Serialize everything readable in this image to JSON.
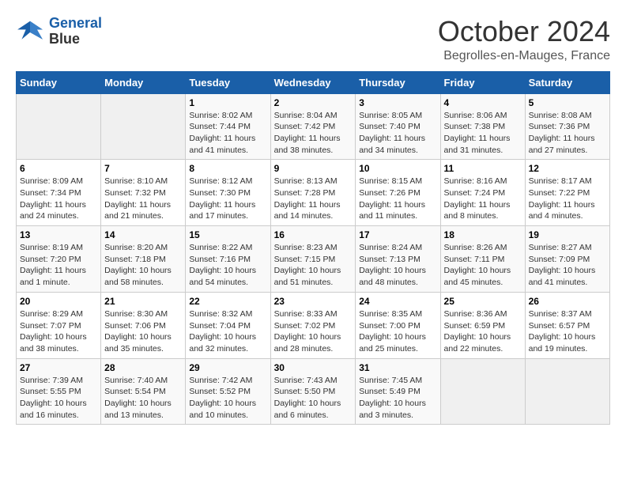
{
  "logo": {
    "line1": "General",
    "line2": "Blue"
  },
  "title": "October 2024",
  "location": "Begrolles-en-Mauges, France",
  "days_header": [
    "Sunday",
    "Monday",
    "Tuesday",
    "Wednesday",
    "Thursday",
    "Friday",
    "Saturday"
  ],
  "weeks": [
    [
      {
        "num": "",
        "info": ""
      },
      {
        "num": "",
        "info": ""
      },
      {
        "num": "1",
        "info": "Sunrise: 8:02 AM\nSunset: 7:44 PM\nDaylight: 11 hours and 41 minutes."
      },
      {
        "num": "2",
        "info": "Sunrise: 8:04 AM\nSunset: 7:42 PM\nDaylight: 11 hours and 38 minutes."
      },
      {
        "num": "3",
        "info": "Sunrise: 8:05 AM\nSunset: 7:40 PM\nDaylight: 11 hours and 34 minutes."
      },
      {
        "num": "4",
        "info": "Sunrise: 8:06 AM\nSunset: 7:38 PM\nDaylight: 11 hours and 31 minutes."
      },
      {
        "num": "5",
        "info": "Sunrise: 8:08 AM\nSunset: 7:36 PM\nDaylight: 11 hours and 27 minutes."
      }
    ],
    [
      {
        "num": "6",
        "info": "Sunrise: 8:09 AM\nSunset: 7:34 PM\nDaylight: 11 hours and 24 minutes."
      },
      {
        "num": "7",
        "info": "Sunrise: 8:10 AM\nSunset: 7:32 PM\nDaylight: 11 hours and 21 minutes."
      },
      {
        "num": "8",
        "info": "Sunrise: 8:12 AM\nSunset: 7:30 PM\nDaylight: 11 hours and 17 minutes."
      },
      {
        "num": "9",
        "info": "Sunrise: 8:13 AM\nSunset: 7:28 PM\nDaylight: 11 hours and 14 minutes."
      },
      {
        "num": "10",
        "info": "Sunrise: 8:15 AM\nSunset: 7:26 PM\nDaylight: 11 hours and 11 minutes."
      },
      {
        "num": "11",
        "info": "Sunrise: 8:16 AM\nSunset: 7:24 PM\nDaylight: 11 hours and 8 minutes."
      },
      {
        "num": "12",
        "info": "Sunrise: 8:17 AM\nSunset: 7:22 PM\nDaylight: 11 hours and 4 minutes."
      }
    ],
    [
      {
        "num": "13",
        "info": "Sunrise: 8:19 AM\nSunset: 7:20 PM\nDaylight: 11 hours and 1 minute."
      },
      {
        "num": "14",
        "info": "Sunrise: 8:20 AM\nSunset: 7:18 PM\nDaylight: 10 hours and 58 minutes."
      },
      {
        "num": "15",
        "info": "Sunrise: 8:22 AM\nSunset: 7:16 PM\nDaylight: 10 hours and 54 minutes."
      },
      {
        "num": "16",
        "info": "Sunrise: 8:23 AM\nSunset: 7:15 PM\nDaylight: 10 hours and 51 minutes."
      },
      {
        "num": "17",
        "info": "Sunrise: 8:24 AM\nSunset: 7:13 PM\nDaylight: 10 hours and 48 minutes."
      },
      {
        "num": "18",
        "info": "Sunrise: 8:26 AM\nSunset: 7:11 PM\nDaylight: 10 hours and 45 minutes."
      },
      {
        "num": "19",
        "info": "Sunrise: 8:27 AM\nSunset: 7:09 PM\nDaylight: 10 hours and 41 minutes."
      }
    ],
    [
      {
        "num": "20",
        "info": "Sunrise: 8:29 AM\nSunset: 7:07 PM\nDaylight: 10 hours and 38 minutes."
      },
      {
        "num": "21",
        "info": "Sunrise: 8:30 AM\nSunset: 7:06 PM\nDaylight: 10 hours and 35 minutes."
      },
      {
        "num": "22",
        "info": "Sunrise: 8:32 AM\nSunset: 7:04 PM\nDaylight: 10 hours and 32 minutes."
      },
      {
        "num": "23",
        "info": "Sunrise: 8:33 AM\nSunset: 7:02 PM\nDaylight: 10 hours and 28 minutes."
      },
      {
        "num": "24",
        "info": "Sunrise: 8:35 AM\nSunset: 7:00 PM\nDaylight: 10 hours and 25 minutes."
      },
      {
        "num": "25",
        "info": "Sunrise: 8:36 AM\nSunset: 6:59 PM\nDaylight: 10 hours and 22 minutes."
      },
      {
        "num": "26",
        "info": "Sunrise: 8:37 AM\nSunset: 6:57 PM\nDaylight: 10 hours and 19 minutes."
      }
    ],
    [
      {
        "num": "27",
        "info": "Sunrise: 7:39 AM\nSunset: 5:55 PM\nDaylight: 10 hours and 16 minutes."
      },
      {
        "num": "28",
        "info": "Sunrise: 7:40 AM\nSunset: 5:54 PM\nDaylight: 10 hours and 13 minutes."
      },
      {
        "num": "29",
        "info": "Sunrise: 7:42 AM\nSunset: 5:52 PM\nDaylight: 10 hours and 10 minutes."
      },
      {
        "num": "30",
        "info": "Sunrise: 7:43 AM\nSunset: 5:50 PM\nDaylight: 10 hours and 6 minutes."
      },
      {
        "num": "31",
        "info": "Sunrise: 7:45 AM\nSunset: 5:49 PM\nDaylight: 10 hours and 3 minutes."
      },
      {
        "num": "",
        "info": ""
      },
      {
        "num": "",
        "info": ""
      }
    ]
  ]
}
